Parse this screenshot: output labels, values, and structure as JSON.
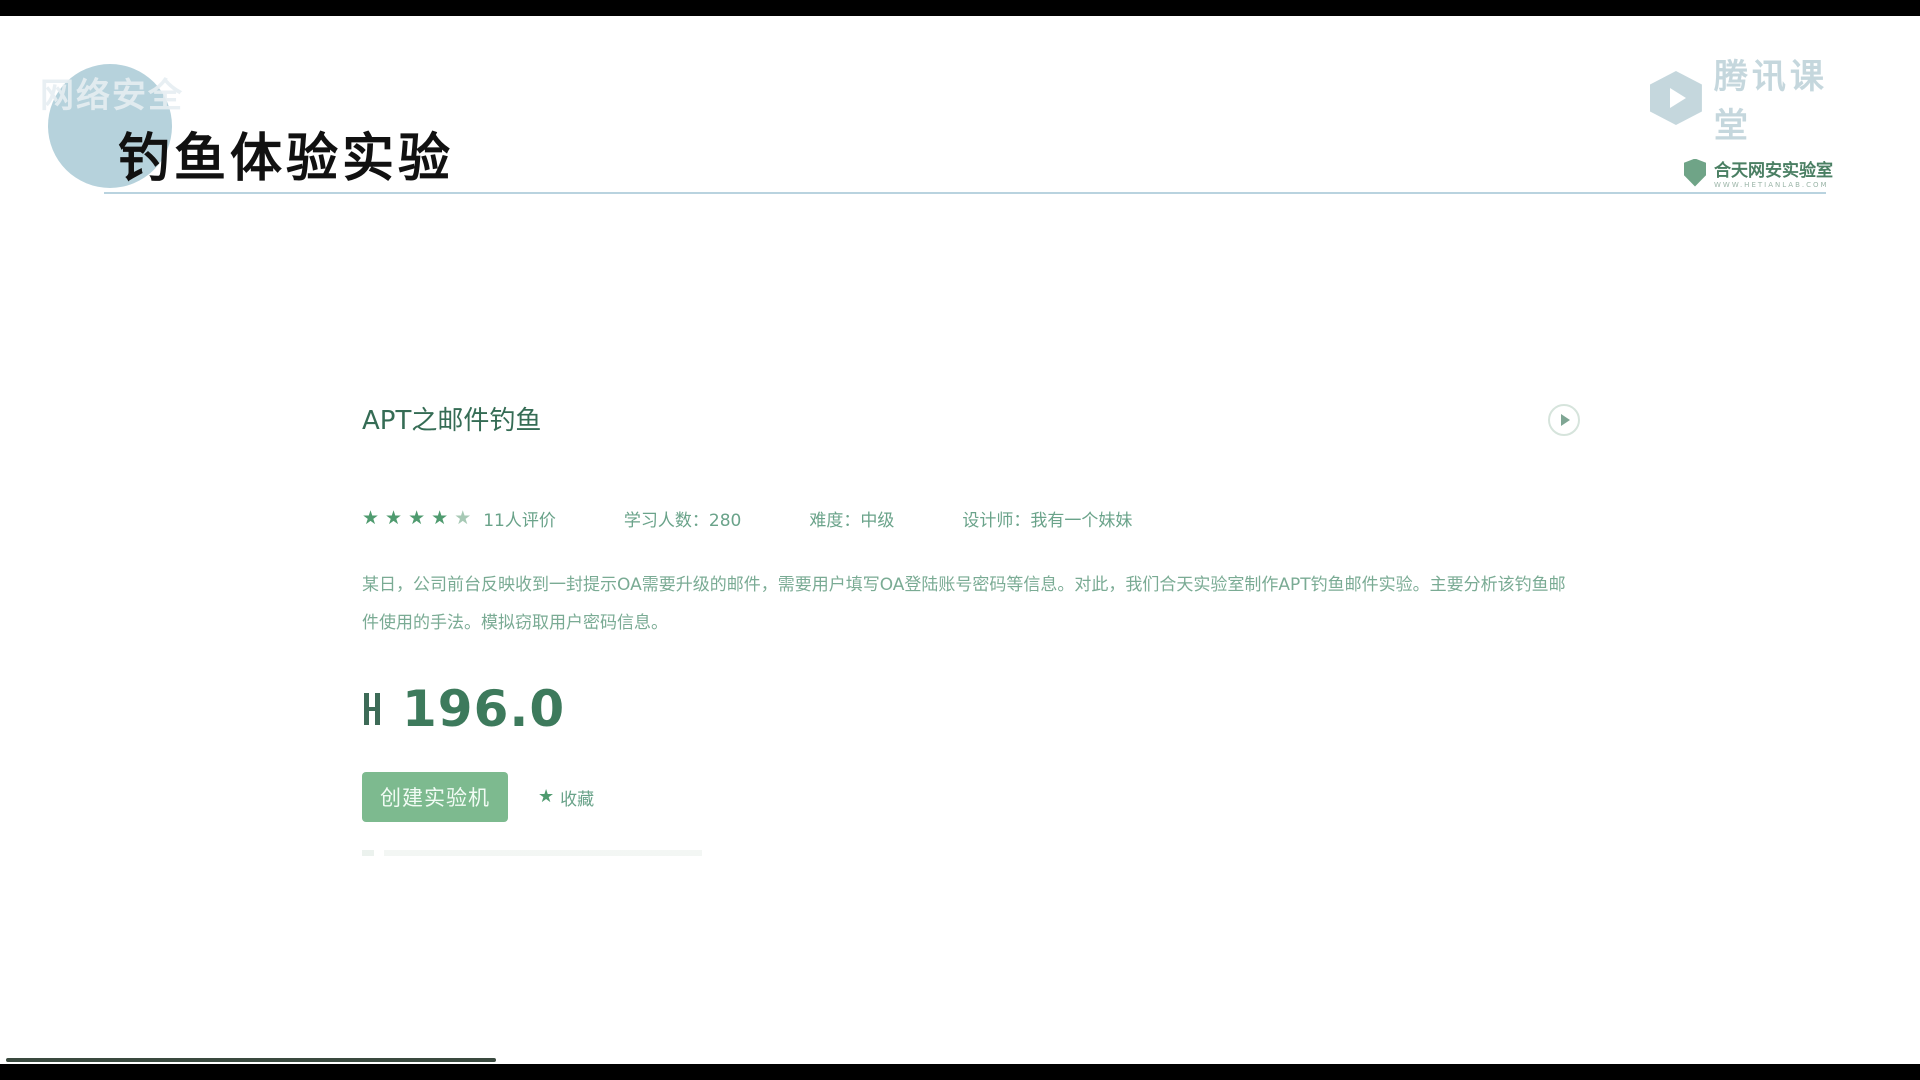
{
  "slide": {
    "title": "钓鱼体验实验",
    "watermark": "网络安全",
    "brand": {
      "name": "腾讯课堂",
      "logo_icon": "tencent-classroom-icon"
    },
    "lab": {
      "name": "合天网安实验室",
      "url": "WWW.HETIANLAB.COM",
      "logo_icon": "shield-icon"
    }
  },
  "course": {
    "title": "APT之邮件钓鱼",
    "rating": {
      "filled_stars": 4,
      "total_stars": 5
    },
    "reviews": "11人评价",
    "learners": "学习人数：280",
    "difficulty": "难度：中级",
    "designer": "设计师：我有一个妹妹",
    "description": "某日，公司前台反映收到一封提示OA需要升级的邮件，需要用户填写OA登陆账号密码等信息。对此，我们合天实验室制作APT钓鱼邮件实验。主要分析该钓鱼邮件使用的手法。模拟窃取用户密码信息。",
    "price": "196.0",
    "create_button": "创建实验机",
    "favorite_label": "收藏",
    "colors": {
      "accent": "#7dba8f",
      "text": "#6aa38a",
      "title": "#356c55"
    }
  }
}
